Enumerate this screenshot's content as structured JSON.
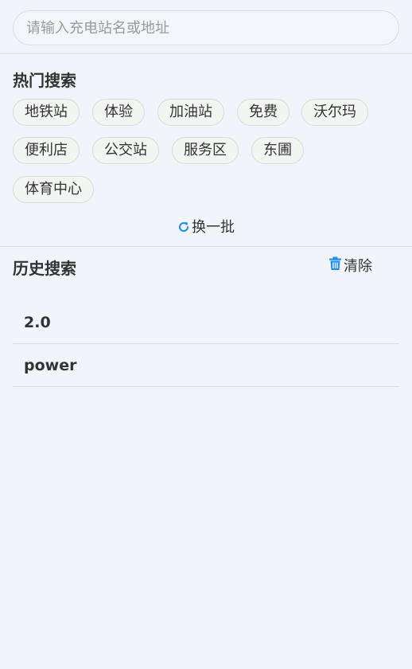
{
  "search": {
    "placeholder": "请输入充电站名或地址",
    "value": ""
  },
  "hot": {
    "title": "热门搜索",
    "tags": [
      "地铁站",
      "体验",
      "加油站",
      "免费",
      "沃尔玛",
      "便利店",
      "公交站",
      "服务区",
      "东圃",
      "体育中心"
    ],
    "refresh_label": "换一批",
    "refresh_icon": "refresh-icon",
    "accent_color": "#1e90e8"
  },
  "history": {
    "title": "历史搜索",
    "clear_label": "清除",
    "clear_icon": "trash-icon",
    "items": [
      "2.0",
      "power"
    ]
  }
}
